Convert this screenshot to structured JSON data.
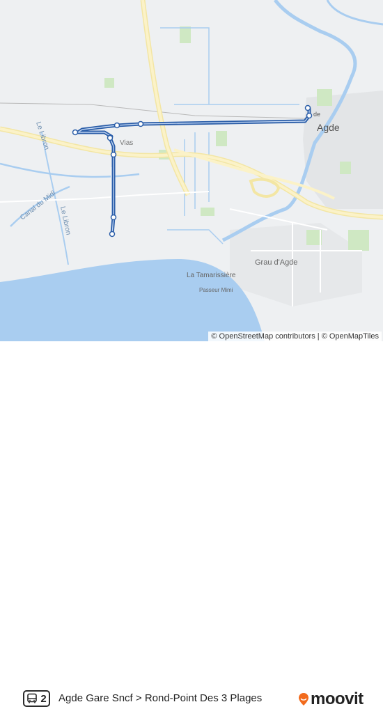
{
  "map": {
    "labels": {
      "agde": "Agde",
      "vias": "Vias",
      "grau_dagde": "Grau d'Agde",
      "la_tamarissiere": "La Tamarissière",
      "passeur_mimi": "Passeur Mimi",
      "le_libron_north": "Le Libron",
      "le_libron_south": "Le Libron",
      "canal_du_midi": "Canal du Midi",
      "de_fragment": "de"
    },
    "attribution": {
      "osm_contrib": "© OpenStreetMap contributors",
      "separator": "|",
      "omt": "© OpenMapTiles"
    },
    "colors": {
      "route_line": "#2a5da8",
      "sea": "#a9cdf0",
      "road_major": "#f6e7a6"
    }
  },
  "footer": {
    "route_number": "2",
    "route_icon": "bus-icon",
    "route_title": "Agde Gare Sncf > Rond-Point Des 3 Plages",
    "brand": "moovit",
    "brand_icon": "moovit-pin-icon"
  }
}
